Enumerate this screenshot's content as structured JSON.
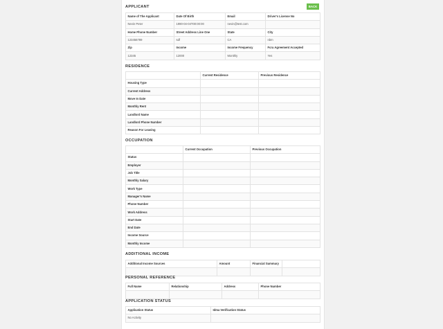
{
  "back_label": "BACK",
  "applicant": {
    "title": "APPLICANT",
    "rows": [
      [
        "Name of The Applicant",
        "Date Of Birth",
        "Email",
        "Driver's License No"
      ],
      [
        "Nevin Peter",
        "1990-04-04T00:00:00",
        "nevin@test.com",
        ""
      ],
      [
        "Home Phone Number",
        "Street Address Line One",
        "State",
        "City"
      ],
      [
        "123456789",
        "sdf",
        "CA",
        "nbm"
      ],
      [
        "Zip",
        "Income",
        "Income Frequency",
        "Fcra Agreement Accepted"
      ],
      [
        "12345",
        "12000",
        "Monthly",
        "Yes"
      ]
    ]
  },
  "residence": {
    "title": "RESIDENCE",
    "columns": [
      "",
      "Current Residence",
      "Previous Residence"
    ],
    "rows": [
      "Housing Type",
      "Current Address",
      "Move In Date",
      "Monthly Rent",
      "Landlord Name",
      "Landlord Phone Number",
      "Reason For Leaving"
    ]
  },
  "occupation": {
    "title": "OCCUPATION",
    "columns": [
      "",
      "Current Occupation",
      "Previous Occupation"
    ],
    "rows": [
      "Status",
      "Employer",
      "Job Title",
      "Monthly Salary",
      "Work Type",
      "Manager's Name",
      "Phone Number",
      "Work Address",
      "Start Date",
      "End Date",
      "Income Source",
      "Monthly Income"
    ]
  },
  "additional_income": {
    "title": "ADDITIONAL INCOME",
    "columns": [
      "Additional Income Sources",
      "Amount",
      "Financial Summary",
      ""
    ]
  },
  "personal_reference": {
    "title": "PERSONAL REFERENCE",
    "columns": [
      "Full Name",
      "Relationship",
      "Address",
      "Phone Number"
    ]
  },
  "application_status": {
    "title": "APPLICATION STATUS",
    "columns": [
      "Application Status",
      "Idma Verification Status"
    ],
    "values": [
      "No Activity",
      ""
    ]
  }
}
